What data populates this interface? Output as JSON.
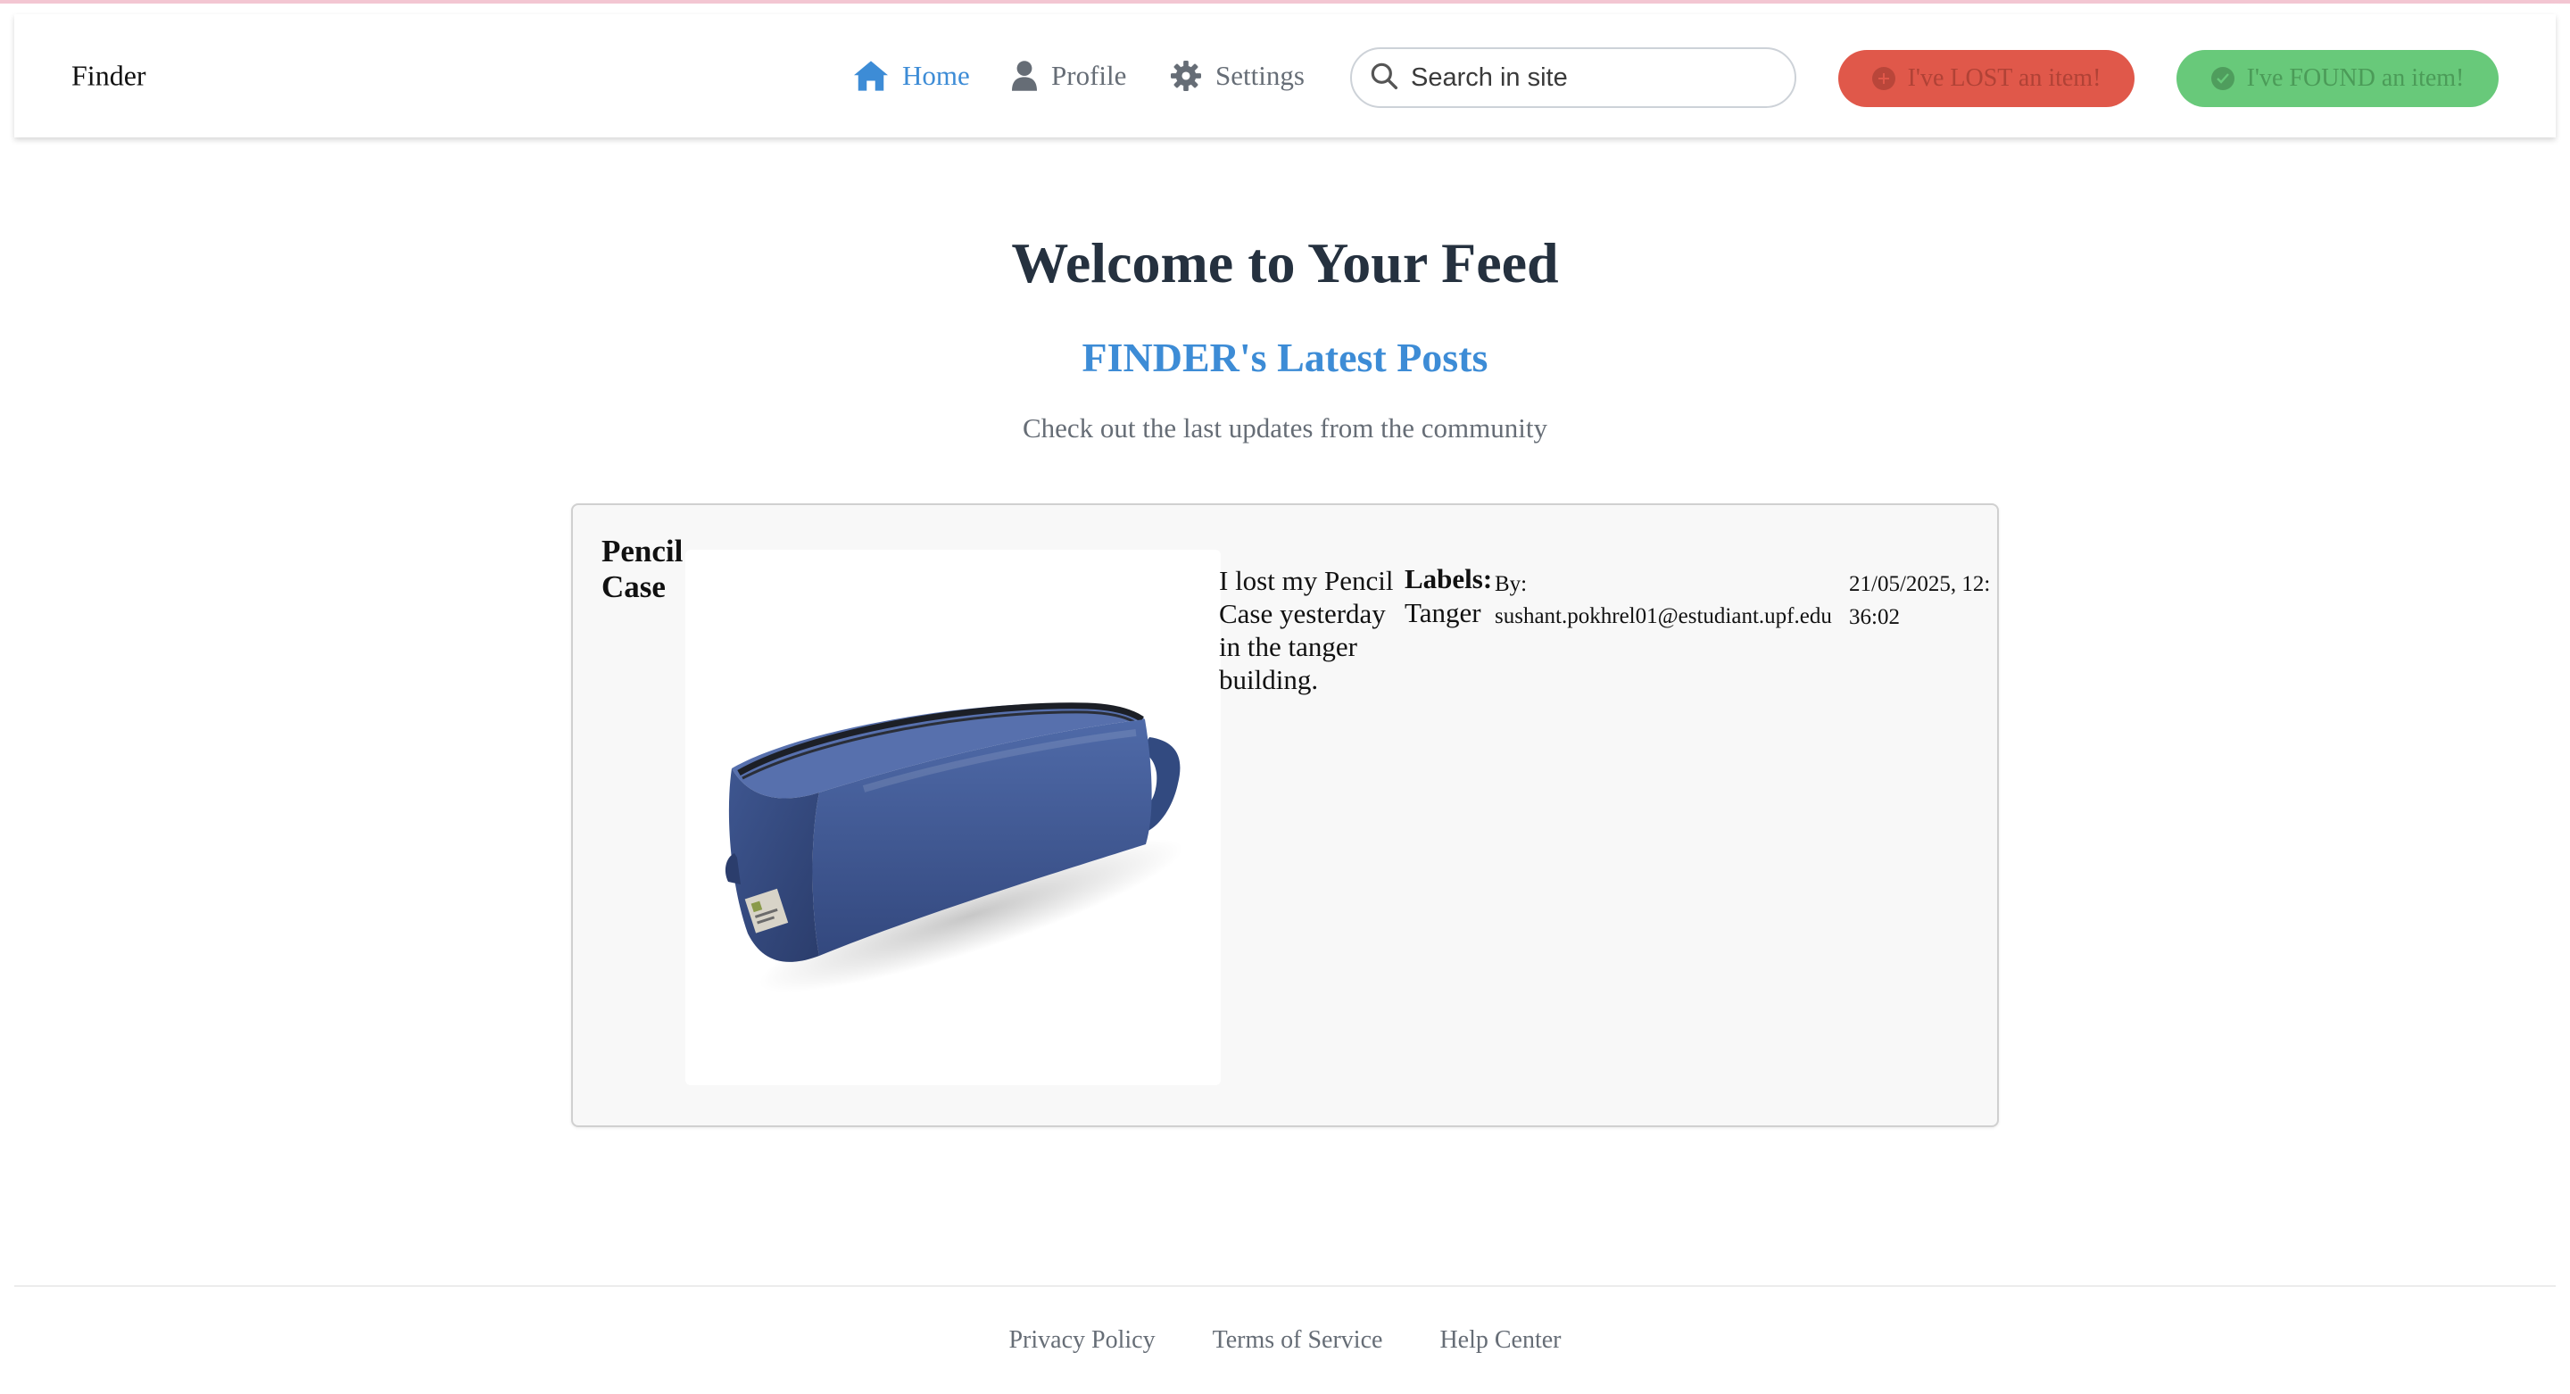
{
  "brand": "Finder",
  "nav": {
    "home": "Home",
    "profile": "Profile",
    "settings": "Settings"
  },
  "search": {
    "placeholder": "Search in site"
  },
  "actions": {
    "lost": "I've LOST an item!",
    "found": "I've FOUND an item!"
  },
  "colors": {
    "accent": "#3d8cd6",
    "lost": "#e0584a",
    "found": "#68c97a",
    "heading": "#25313f",
    "muted": "#666d76"
  },
  "hero": {
    "title": "Welcome to Your Feed",
    "subtitle": "FINDER's Latest Posts",
    "description": "Check out the last updates from the community"
  },
  "posts": [
    {
      "title": "Pencil Case",
      "image": "blue-pencil-case-photo",
      "description": "I lost my Pencil Case yesterday in the tanger building.",
      "labels_heading": "Labels:",
      "label": "Tanger",
      "by_label": "By:",
      "author": "sushant.pokhrel01@estudiant.upf.edu",
      "timestamp": "21/05/2025, 12:36:02"
    }
  ],
  "footer": {
    "privacy": "Privacy Policy",
    "terms": "Terms of Service",
    "help": "Help Center"
  }
}
